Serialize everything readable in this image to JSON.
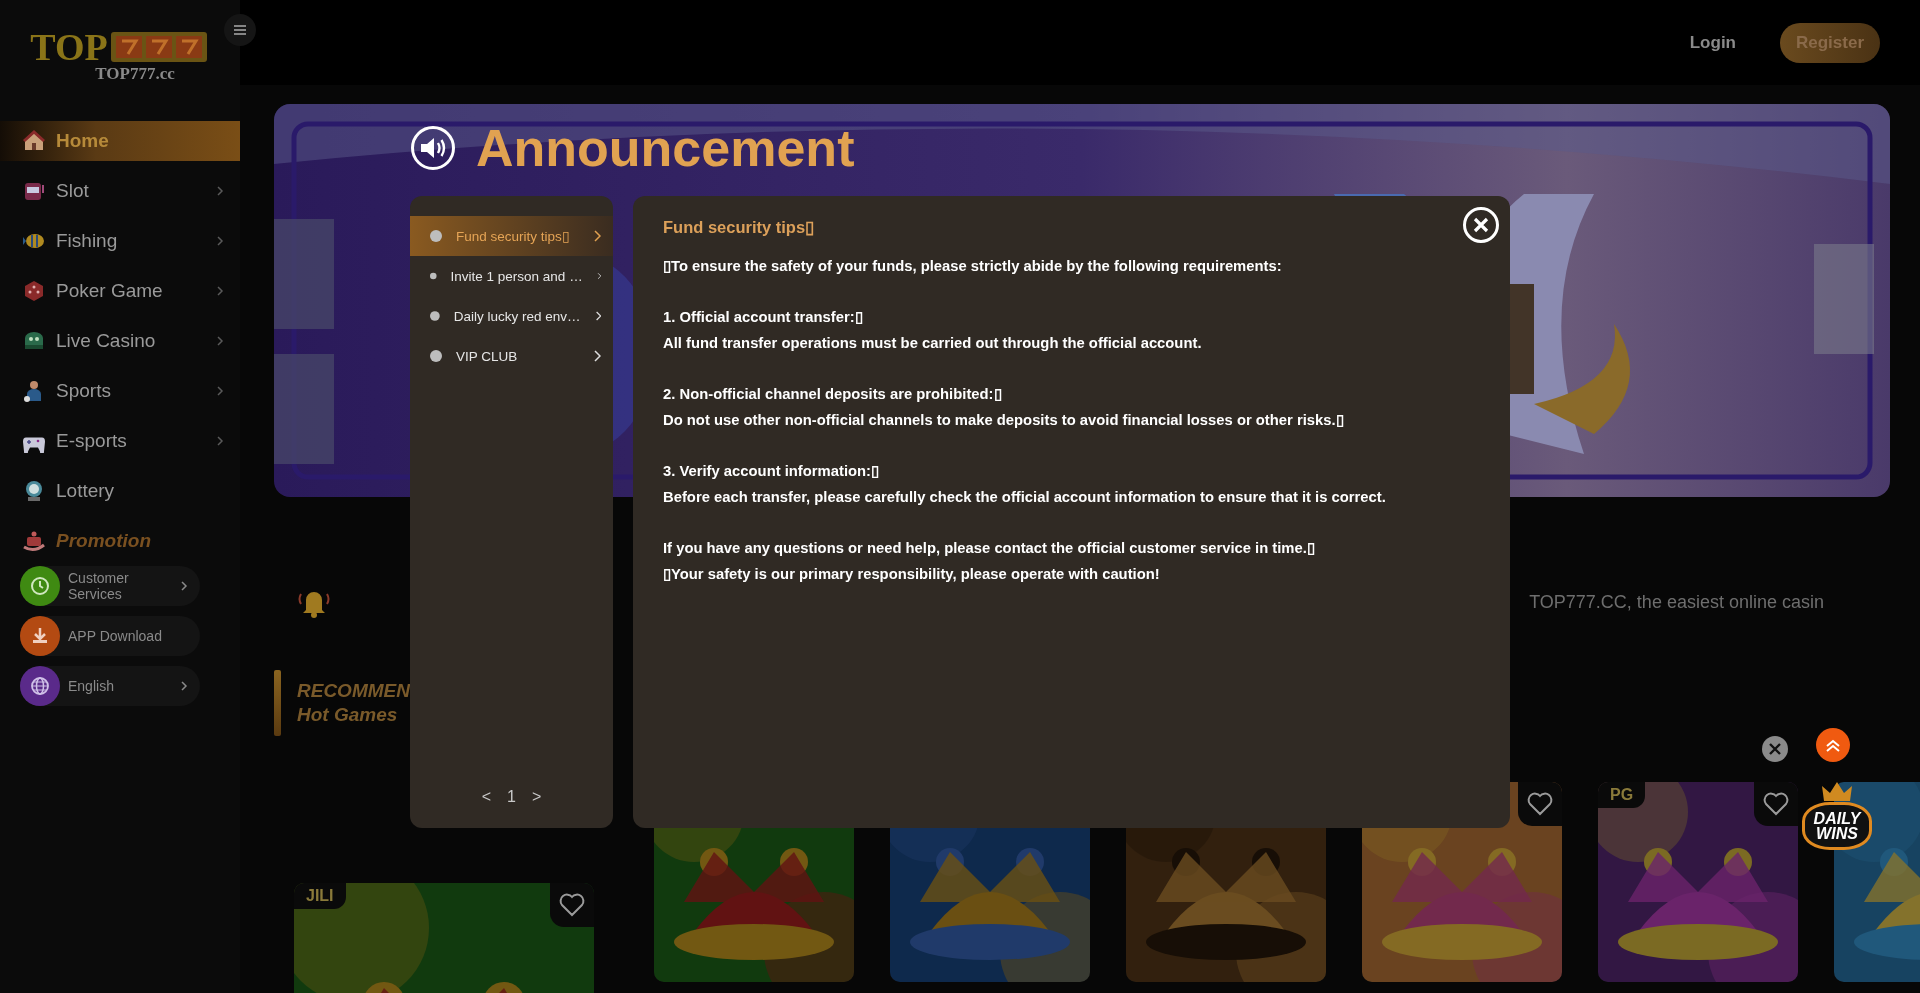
{
  "sidebar": {
    "logo": {
      "wordmark": "TOP",
      "domain": "TOP777.cc"
    },
    "items": [
      {
        "label": "Home",
        "kind": "home",
        "selected": true,
        "has_arrow": false
      },
      {
        "label": "Slot",
        "kind": "slot",
        "selected": false,
        "has_arrow": true
      },
      {
        "label": "Fishing",
        "kind": "fishing",
        "selected": false,
        "has_arrow": true
      },
      {
        "label": "Poker Game",
        "kind": "poker",
        "selected": false,
        "has_arrow": true
      },
      {
        "label": "Live Casino",
        "kind": "live",
        "selected": false,
        "has_arrow": true
      },
      {
        "label": "Sports",
        "kind": "sports",
        "selected": false,
        "has_arrow": true
      },
      {
        "label": "E-sports",
        "kind": "esports",
        "selected": false,
        "has_arrow": true
      },
      {
        "label": "Lottery",
        "kind": "lottery",
        "selected": false,
        "has_arrow": false
      },
      {
        "label": "Promotion",
        "kind": "promotion",
        "selected": false,
        "has_arrow": false
      }
    ],
    "utility_items": [
      {
        "label": "Customer Services",
        "kind": "support",
        "color": "#3f8a12",
        "has_arrow": true
      },
      {
        "label": "APP Download",
        "kind": "download",
        "color": "#b34a12",
        "has_arrow": false
      },
      {
        "label": "English",
        "kind": "language",
        "color": "#5a2a8a",
        "has_arrow": true
      }
    ]
  },
  "header": {
    "login": "Login",
    "register": "Register"
  },
  "marquee": {
    "text": "TOP777.CC, the easiest online casin"
  },
  "section": {
    "title": "RECOMMEN",
    "subtitle": "Hot Games"
  },
  "featured_game": {
    "provider": "JILI",
    "favorite": false
  },
  "games": [
    {
      "kind": "picture"
    },
    {
      "kind": "picture"
    },
    {
      "kind": "picture"
    },
    {
      "kind": "picture",
      "favorite": false
    },
    {
      "kind": "picture",
      "provider": "PG",
      "favorite": false
    },
    {
      "kind": "picture"
    }
  ],
  "daily_wins": {
    "text": "DAILY WINS"
  },
  "announcement": {
    "title": "Announcement",
    "tabs": [
      {
        "label": "Fund security tips▯",
        "selected": true
      },
      {
        "label": "Invite 1 person and …",
        "selected": false
      },
      {
        "label": "Daily lucky red env…",
        "selected": false
      },
      {
        "label": "VIP CLUB",
        "selected": false
      }
    ],
    "pager": {
      "prev": "<",
      "page": "1",
      "next": ">"
    },
    "heading": "Fund security tips▯",
    "blocks": [
      [
        "▯To ensure the safety of your funds, please strictly abide by the following requirements:"
      ],
      [
        "1. Official account transfer:▯",
        "All fund transfer operations must be carried out through the official account."
      ],
      [
        "2. Non-official channel deposits are prohibited:▯",
        "Do not use other non-official channels to make deposits to avoid financial losses or other risks.▯"
      ],
      [
        "3. Verify account information:▯",
        "Before each transfer, please carefully check the official account information to ensure that it is correct."
      ],
      [
        "If you have any questions or need help, please contact the official customer service in time.▯",
        "▯Your safety is our primary responsibility, please operate with caution!"
      ]
    ]
  }
}
